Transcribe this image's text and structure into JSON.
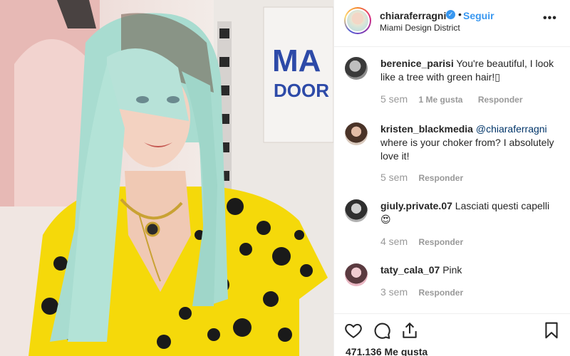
{
  "post": {
    "username": "chiaraferragni",
    "verified_icon": "verified-badge-icon",
    "follow_label": "Seguir",
    "location": "Miami Design District",
    "more_icon": "more-options-icon",
    "likes_text": "471.136 Me gusta"
  },
  "photo": {
    "sign_text": "MA",
    "sign_text2": "DOOR"
  },
  "comments": [
    {
      "user": "berenice_parisi",
      "mention": "",
      "text": "You're beautiful, I look like a tree with green hair!▯",
      "time": "5 sem",
      "likes": "1 Me gusta",
      "reply": "Responder"
    },
    {
      "user": "kristen_blackmedia",
      "mention": "@chiaraferragni",
      "text": "where is your choker from? I absolutely love it!",
      "time": "5 sem",
      "likes": "",
      "reply": "Responder"
    },
    {
      "user": "giuly.private.07",
      "mention": "",
      "text": "Lasciati questi capelli 😍",
      "time": "4 sem",
      "likes": "",
      "reply": "Responder"
    },
    {
      "user": "taty_cala_07",
      "mention": "",
      "text": "Pink",
      "time": "3 sem",
      "likes": "",
      "reply": "Responder"
    }
  ],
  "icons": {
    "like": "heart-icon",
    "comment": "comment-icon",
    "share": "share-icon",
    "save": "bookmark-icon"
  },
  "colors": {
    "link_blue": "#3897f0",
    "text": "#262626",
    "muted": "#999999",
    "border": "#efefef",
    "dress_yellow": "#f5d90a",
    "hair_mint": "#a8dcd0"
  }
}
